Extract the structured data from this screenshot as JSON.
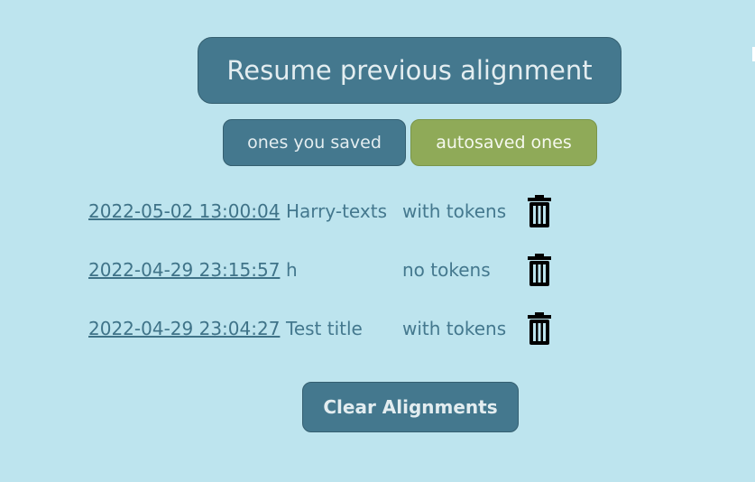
{
  "header": {
    "resume_label": "Resume previous alignment"
  },
  "tabs": {
    "saved_label": "ones you saved",
    "autosaved_label": "autosaved ones",
    "active": "autosaved"
  },
  "alignments": [
    {
      "date": "2022-05-02 13:00:04",
      "title": "Harry-texts",
      "tokens": "with tokens",
      "icon": "trash-icon"
    },
    {
      "date": "2022-04-29 23:15:57",
      "title": "h",
      "tokens": "no tokens",
      "icon": "trash-icon"
    },
    {
      "date": "2022-04-29 23:04:27",
      "title": "Test title",
      "tokens": "with tokens",
      "icon": "trash-icon"
    }
  ],
  "footer": {
    "clear_label": "Clear Alignments"
  },
  "colors": {
    "background": "#bde4ee",
    "primary": "#44788e",
    "active_tab": "#8faa58"
  }
}
